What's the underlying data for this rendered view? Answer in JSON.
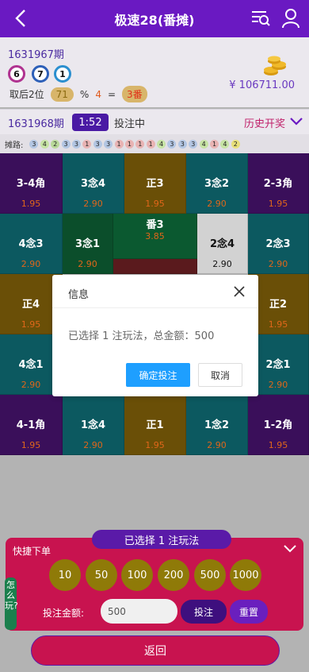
{
  "header": {
    "title": "极速28(番摊)"
  },
  "info": {
    "prev_issue": "1631967期",
    "balls": [
      "6",
      "7",
      "1"
    ],
    "calc": {
      "label": "取后2位",
      "value": "71",
      "op": "%",
      "divisor": "4",
      "eq": "=",
      "result": "3番"
    },
    "balance": "¥ 106711.00"
  },
  "betbar": {
    "issue": "1631968期",
    "timer": "1:52",
    "status": "投注中",
    "history": "历史开奖"
  },
  "trend": {
    "label": "摊路:",
    "values": [
      "3",
      "4",
      "2",
      "3",
      "3",
      "1",
      "3",
      "3",
      "1",
      "1",
      "1",
      "1",
      "4",
      "3",
      "3",
      "3",
      "4",
      "1",
      "4",
      "2"
    ],
    "colors": {
      "1": "#e8b3b3",
      "2": "#b9d99a",
      "3": "#b3c6e3",
      "4": "#c6e3a4"
    }
  },
  "grid": {
    "row1": [
      {
        "label": "3-4角",
        "odds": "1.95",
        "color": "purple"
      },
      {
        "label": "3念4",
        "odds": "2.90",
        "color": "teal"
      },
      {
        "label": "正3",
        "odds": "1.95",
        "color": "gold"
      },
      {
        "label": "3念2",
        "odds": "2.90",
        "color": "teal"
      },
      {
        "label": "2-3角",
        "odds": "1.95",
        "color": "purple"
      }
    ],
    "row2": [
      {
        "label": "4念3",
        "odds": "2.90",
        "color": "teal"
      },
      {
        "label": "3念1",
        "odds": "2.90",
        "color": "green"
      },
      {
        "label": "番3",
        "odds": "3.85",
        "color": "fan3"
      },
      {
        "label": "2念4",
        "odds": "2.90",
        "color": "white"
      },
      {
        "label": "2念3",
        "odds": "2.90",
        "color": "teal"
      }
    ],
    "row3": [
      {
        "label": "正4",
        "odds": "1.95",
        "color": "gold"
      },
      {
        "label": "正2",
        "odds": "1.95",
        "color": "gold"
      }
    ],
    "row4": [
      {
        "label": "4念1",
        "odds": "2.90",
        "color": "teal"
      },
      {
        "label": "2念1",
        "odds": "2.90",
        "color": "teal"
      }
    ],
    "row5": [
      {
        "label": "4-1角",
        "odds": "1.95",
        "color": "purple"
      },
      {
        "label": "1念4",
        "odds": "2.90",
        "color": "teal"
      },
      {
        "label": "正1",
        "odds": "1.95",
        "color": "gold"
      },
      {
        "label": "1念2",
        "odds": "2.90",
        "color": "teal"
      },
      {
        "label": "1-2角",
        "odds": "1.95",
        "color": "purple"
      }
    ]
  },
  "dialog": {
    "title": "信息",
    "message": "已选择 1 注玩法，总金额：500",
    "confirm": "确定投注",
    "cancel": "取消"
  },
  "panel": {
    "selected": "已选择 1 注玩法",
    "quick_label": "快捷下单",
    "chips": [
      "10",
      "50",
      "100",
      "200",
      "500",
      "1000"
    ],
    "amount_label": "投注金额:",
    "amount_value": "500",
    "bet_button": "投注",
    "reset_button": "重置"
  },
  "howplay": "怎么玩?",
  "back_button": "返回"
}
